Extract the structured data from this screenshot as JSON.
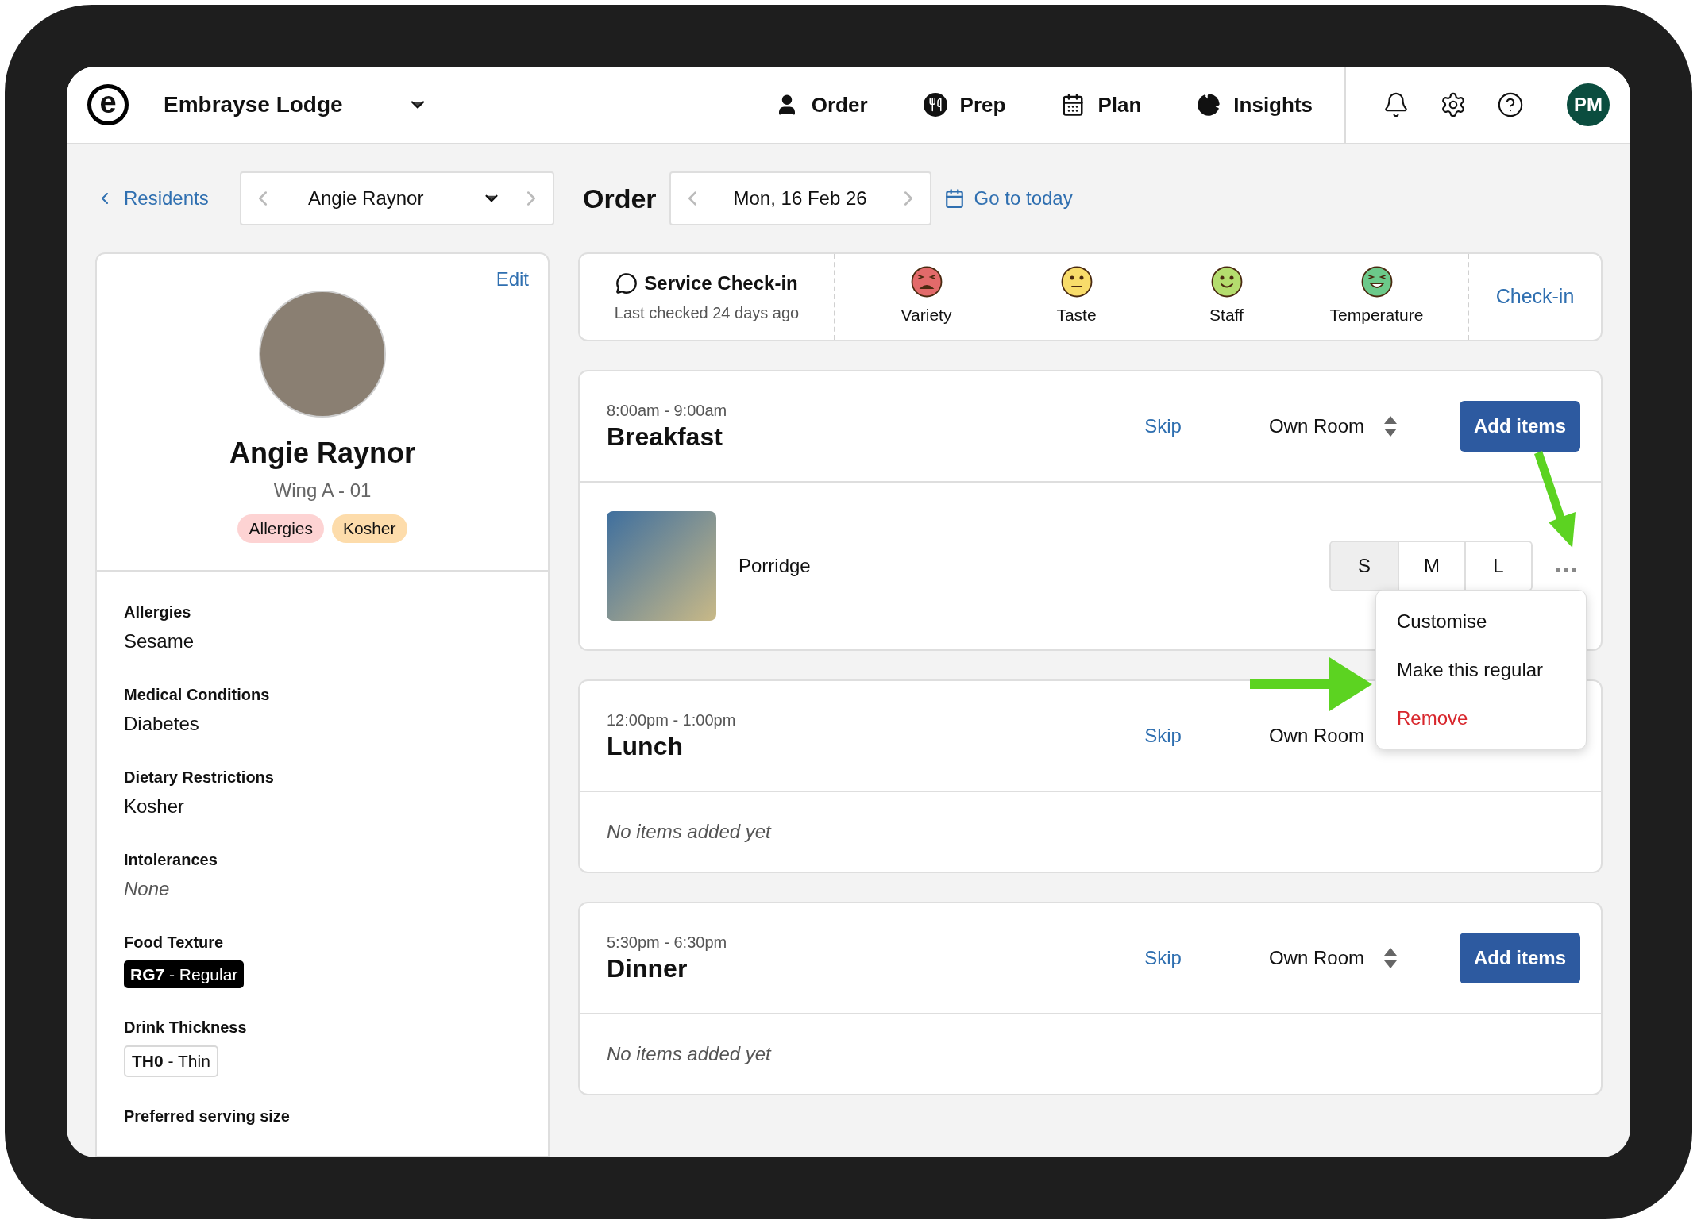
{
  "header": {
    "logo_letter": "e",
    "venue": "Embrayse Lodge",
    "nav": [
      {
        "label": "Order",
        "kind": "person"
      },
      {
        "label": "Prep",
        "kind": "utensils"
      },
      {
        "label": "Plan",
        "kind": "calendar"
      },
      {
        "label": "Insights",
        "kind": "chart"
      }
    ],
    "avatar": "PM"
  },
  "subbar": {
    "back": "Residents",
    "resident": "Angie Raynor",
    "page_title": "Order",
    "date": "Mon, 16 Feb 26",
    "today_link": "Go to today"
  },
  "profile": {
    "edit": "Edit",
    "name": "Angie Raynor",
    "room": "Wing A - 01",
    "tags": [
      {
        "label": "Allergies",
        "color": "#fdd3d3"
      },
      {
        "label": "Kosher",
        "color": "#fddcab"
      }
    ],
    "fields": [
      {
        "label": "Allergies",
        "value": "Sesame",
        "kind": "text"
      },
      {
        "label": "Medical Conditions",
        "value": "Diabetes",
        "kind": "text"
      },
      {
        "label": "Dietary Restrictions",
        "value": "Kosher",
        "kind": "text"
      },
      {
        "label": "Intolerances",
        "value": "None",
        "kind": "empty"
      },
      {
        "label": "Food Texture",
        "value": "**RG7** - Regular",
        "kind": "dark_badge"
      },
      {
        "label": "Drink Thickness",
        "value": "**TH0** - Thin",
        "kind": "outline_badge"
      },
      {
        "label": "Preferred serving size",
        "kind": "heading"
      }
    ]
  },
  "checkin": {
    "title": "Service Check-in",
    "subtitle": "Last checked 24 days ago",
    "ratings": [
      {
        "label": "Variety",
        "kind": "angry",
        "color": "#e26a6a"
      },
      {
        "label": "Taste",
        "kind": "neutral",
        "color": "#f8dc6a"
      },
      {
        "label": "Staff",
        "kind": "smile",
        "color": "#b4dd6e"
      },
      {
        "label": "Temperature",
        "kind": "grin",
        "color": "#6cc98a"
      }
    ],
    "action": "Check-in"
  },
  "meals": [
    {
      "time": "8:00am - 9:00am",
      "name": "Breakfast",
      "skip": "Skip",
      "location": "Own Room",
      "add_button": "Add items",
      "items": [
        {
          "name": "Porridge",
          "sizes": [
            {
              "label": "S",
              "selected": true
            },
            {
              "label": "M",
              "selected": false
            },
            {
              "label": "L",
              "selected": false
            }
          ]
        }
      ]
    },
    {
      "time": "12:00pm - 1:00pm",
      "name": "Lunch",
      "skip": "Skip",
      "location": "Own Room",
      "empty_text": "No items added yet"
    },
    {
      "time": "5:30pm - 6:30pm",
      "name": "Dinner",
      "skip": "Skip",
      "location": "Own Room",
      "add_button": "Add items",
      "empty_text": "No items added yet"
    }
  ],
  "menu": {
    "items": [
      {
        "label": "Customise",
        "kind": "normal"
      },
      {
        "label": "Make this regular",
        "kind": "normal"
      },
      {
        "label": "Remove",
        "kind": "danger"
      }
    ]
  }
}
